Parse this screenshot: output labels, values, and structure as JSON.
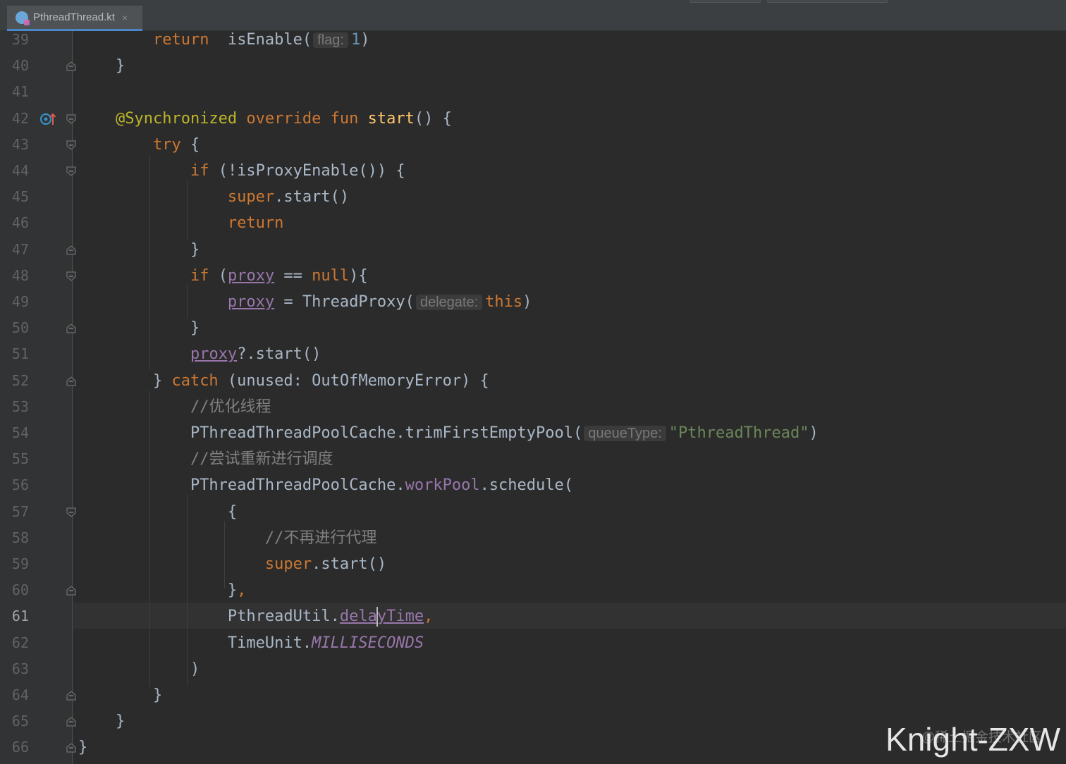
{
  "tab": {
    "label": "PthreadThread.kt",
    "close": "×",
    "icon": "kotlin-file-icon"
  },
  "colors": {
    "keyword": "#cc7832",
    "annotation": "#bbb529",
    "function": "#ffc66d",
    "number": "#6897bb",
    "string": "#6a8759",
    "comment": "#808080",
    "property": "#9876aa",
    "text": "#a9b7c6",
    "background": "#2b2b2b"
  },
  "current_line": 61,
  "lines": [
    {
      "n": "39",
      "tokens": [
        {
          "t": "        "
        },
        {
          "t": "return",
          "c": "kw"
        },
        {
          "t": "  isEnable("
        },
        {
          "t": "flag:",
          "c": "hint"
        },
        {
          "t": "1",
          "c": "num"
        },
        {
          "t": ")"
        }
      ]
    },
    {
      "n": "40",
      "fold": "end",
      "tokens": [
        {
          "t": "    }"
        }
      ]
    },
    {
      "n": "41",
      "tokens": []
    },
    {
      "n": "42",
      "fold": "start",
      "marker": "override-gutter-icon",
      "tokens": [
        {
          "t": "    "
        },
        {
          "t": "@Synchronized",
          "c": "ann"
        },
        {
          "t": " "
        },
        {
          "t": "override",
          "c": "kw"
        },
        {
          "t": " "
        },
        {
          "t": "fun",
          "c": "kw"
        },
        {
          "t": " "
        },
        {
          "t": "start",
          "c": "fn"
        },
        {
          "t": "() {"
        }
      ]
    },
    {
      "n": "43",
      "fold": "start",
      "tokens": [
        {
          "t": "        "
        },
        {
          "t": "try",
          "c": "kw"
        },
        {
          "t": " {"
        }
      ]
    },
    {
      "n": "44",
      "fold": "start",
      "tokens": [
        {
          "t": "            "
        },
        {
          "t": "if",
          "c": "kw"
        },
        {
          "t": " (!isProxyEnable()) {"
        }
      ]
    },
    {
      "n": "45",
      "tokens": [
        {
          "t": "                "
        },
        {
          "t": "super",
          "c": "kw"
        },
        {
          "t": ".start()"
        }
      ]
    },
    {
      "n": "46",
      "tokens": [
        {
          "t": "                "
        },
        {
          "t": "return",
          "c": "kw"
        }
      ]
    },
    {
      "n": "47",
      "fold": "end",
      "tokens": [
        {
          "t": "            }"
        }
      ]
    },
    {
      "n": "48",
      "fold": "start",
      "tokens": [
        {
          "t": "            "
        },
        {
          "t": "if",
          "c": "kw"
        },
        {
          "t": " ("
        },
        {
          "t": "proxy",
          "c": "ulprop"
        },
        {
          "t": " == "
        },
        {
          "t": "null",
          "c": "kw"
        },
        {
          "t": "){"
        }
      ]
    },
    {
      "n": "49",
      "tokens": [
        {
          "t": "                "
        },
        {
          "t": "proxy",
          "c": "ulprop"
        },
        {
          "t": " = ThreadProxy("
        },
        {
          "t": "delegate:",
          "c": "hint"
        },
        {
          "t": "this",
          "c": "kw"
        },
        {
          "t": ")"
        }
      ]
    },
    {
      "n": "50",
      "fold": "end",
      "tokens": [
        {
          "t": "            }"
        }
      ]
    },
    {
      "n": "51",
      "tokens": [
        {
          "t": "            "
        },
        {
          "t": "proxy",
          "c": "ulprop"
        },
        {
          "t": "?.start()"
        }
      ]
    },
    {
      "n": "52",
      "fold": "end",
      "tokens": [
        {
          "t": "        } "
        },
        {
          "t": "catch",
          "c": "kw"
        },
        {
          "t": " (unused: OutOfMemoryError) {"
        }
      ]
    },
    {
      "n": "53",
      "tokens": [
        {
          "t": "            "
        },
        {
          "t": "//优化线程",
          "c": "cmt"
        }
      ]
    },
    {
      "n": "54",
      "tokens": [
        {
          "t": "            PThreadThreadPoolCache.trimFirstEmptyPool("
        },
        {
          "t": "queueType:",
          "c": "hint"
        },
        {
          "t": "\"PthreadThread\"",
          "c": "str"
        },
        {
          "t": ")"
        }
      ]
    },
    {
      "n": "55",
      "tokens": [
        {
          "t": "            "
        },
        {
          "t": "//尝试重新进行调度",
          "c": "cmt"
        }
      ]
    },
    {
      "n": "56",
      "tokens": [
        {
          "t": "            PThreadThreadPoolCache."
        },
        {
          "t": "workPool",
          "c": "prop"
        },
        {
          "t": ".schedule("
        }
      ]
    },
    {
      "n": "57",
      "fold": "start",
      "tokens": [
        {
          "t": "                {"
        }
      ]
    },
    {
      "n": "58",
      "tokens": [
        {
          "t": "                    "
        },
        {
          "t": "//不再进行代理",
          "c": "cmt"
        }
      ]
    },
    {
      "n": "59",
      "tokens": [
        {
          "t": "                    "
        },
        {
          "t": "super",
          "c": "kw"
        },
        {
          "t": ".start()"
        }
      ]
    },
    {
      "n": "60",
      "fold": "end",
      "tokens": [
        {
          "t": "                }"
        },
        {
          "t": ",",
          "c": "kw"
        }
      ]
    },
    {
      "n": "61",
      "tokens": [
        {
          "t": "                PthreadUtil."
        },
        {
          "t": "dela",
          "c": "ulprop"
        },
        {
          "t": "",
          "c": "caret"
        },
        {
          "t": "yTime",
          "c": "ulprop"
        },
        {
          "t": ",",
          "c": "kw"
        }
      ]
    },
    {
      "n": "62",
      "tokens": [
        {
          "t": "                TimeUnit."
        },
        {
          "t": "MILLISECONDS",
          "c": "ital"
        }
      ]
    },
    {
      "n": "63",
      "tokens": [
        {
          "t": "            )"
        }
      ]
    },
    {
      "n": "64",
      "fold": "end",
      "tokens": [
        {
          "t": "        }"
        }
      ]
    },
    {
      "n": "65",
      "fold": "end",
      "tokens": [
        {
          "t": "    }"
        }
      ]
    },
    {
      "n": "66",
      "fold": "end",
      "tokens": [
        {
          "t": "}"
        }
      ]
    }
  ],
  "watermark": {
    "main": "Knight-ZXW",
    "sub": "@稀土掘金技术社区"
  }
}
